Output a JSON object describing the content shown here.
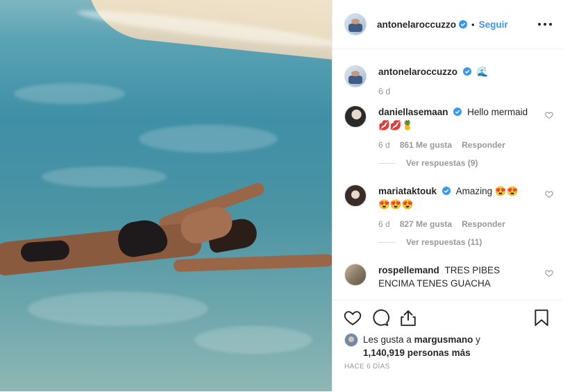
{
  "post": {
    "author": "antonelaroccuzzo",
    "follow_label": "Seguir",
    "dot": "•",
    "caption_emoji": "🌊",
    "caption_time": "6 d"
  },
  "comments": [
    {
      "username": "daniellasemaan",
      "verified": true,
      "text_line1": "Hello mermaid",
      "text_line2": "💋💋🍍",
      "time": "6 d",
      "likes": "861 Me gusta",
      "reply_label": "Responder",
      "view_replies": "Ver respuestas (9)"
    },
    {
      "username": "mariataktouk",
      "verified": true,
      "text_line1": "Amazing 😍😍",
      "text_line2": "😍😍😍",
      "time": "6 d",
      "likes": "827 Me gusta",
      "reply_label": "Responder",
      "view_replies": "Ver respuestas (11)"
    },
    {
      "username": "rospellemand",
      "verified": false,
      "text_line1": "TRES PIBES",
      "text_line2": "ENCIMA TENES GUACHA"
    }
  ],
  "likes_summary": {
    "prefix": "Les gusta a",
    "user": "margusmano",
    "conjunction": "y",
    "count": "1,140,919 personas más"
  },
  "date_label": "HACE 6 DÍAS",
  "icons": {
    "like": "heart-icon",
    "comment": "comment-icon",
    "share": "share-icon",
    "save": "bookmark-icon",
    "more": "more-options-icon",
    "verified": "verified-badge-icon"
  },
  "colors": {
    "link": "#3897f0",
    "verified": "#3897f0",
    "muted": "#999999",
    "text": "#262626"
  }
}
